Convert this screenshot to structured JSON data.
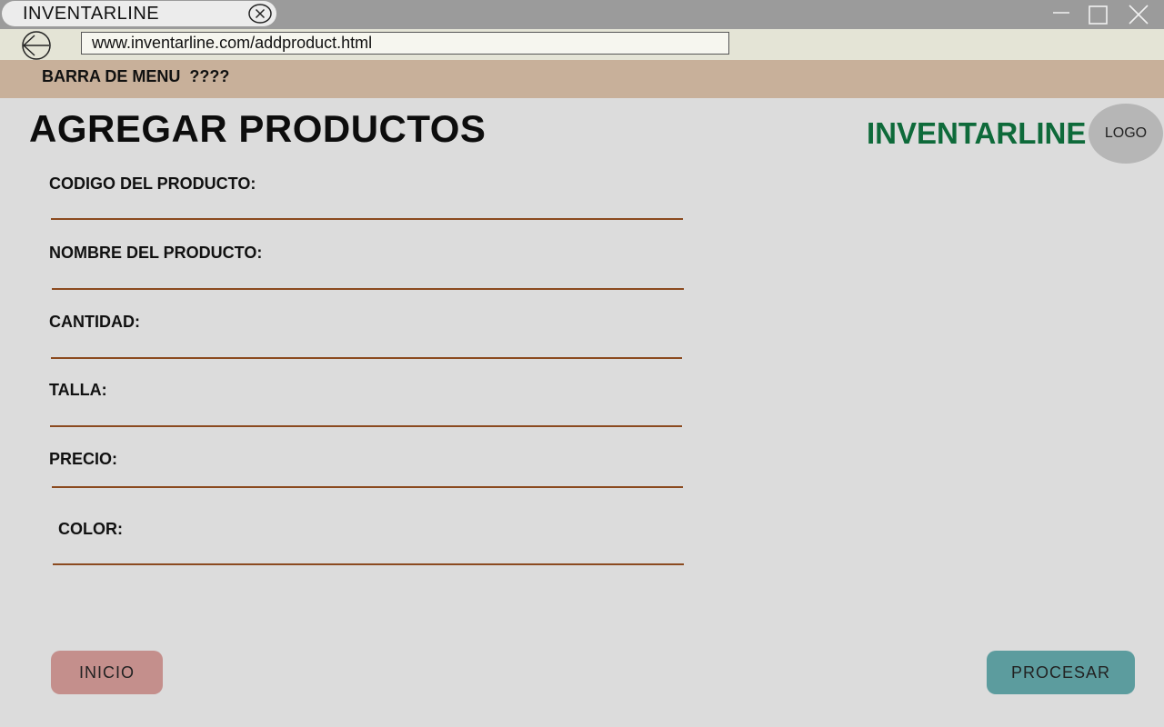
{
  "window": {
    "tab_title": "INVENTARLINE"
  },
  "address_bar": {
    "url": "www.inventarline.com/addproduct.html"
  },
  "menu_bar": {
    "label": "BARRA DE MENU  ????"
  },
  "header": {
    "title": "AGREGAR PRODUCTOS",
    "brand": "INVENTARLINE",
    "logo_text": "LOGO"
  },
  "form": {
    "fields": [
      {
        "label": "CODIGO DEL PRODUCTO:",
        "value": ""
      },
      {
        "label": "NOMBRE DEL PRODUCTO:",
        "value": ""
      },
      {
        "label": "CANTIDAD:",
        "value": ""
      },
      {
        "label": "TALLA:",
        "value": ""
      },
      {
        "label": "PRECIO:",
        "value": ""
      },
      {
        "label": "COLOR:",
        "value": ""
      }
    ]
  },
  "actions": {
    "inicio_label": "INICIO",
    "procesar_label": "PROCESAR"
  },
  "colors": {
    "menu_bar": "#c8b09a",
    "brand": "#0e6a3a",
    "field_line": "#8b4a1f",
    "inicio_button": "#c48f8c",
    "procesar_button": "#5c9c9e"
  },
  "icons": {
    "tab_close": "close-circle-icon",
    "back": "back-arrow-icon",
    "minimize": "minimize-icon",
    "maximize": "maximize-icon",
    "close": "close-icon"
  }
}
